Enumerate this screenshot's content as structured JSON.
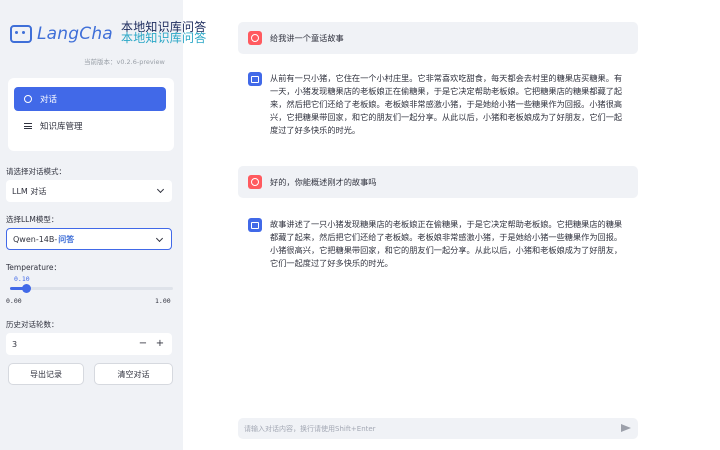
{
  "sidebar": {
    "logo_text": "LangCha",
    "logo_overlay_line1": "本地知识库问答",
    "logo_overlay_line2": "本地知识库问答",
    "version": "当前版本：v0.2.6-preview",
    "nav": [
      {
        "label": "对话",
        "icon": "chat-bubble-icon",
        "active": true
      },
      {
        "label": "知识库管理",
        "icon": "database-icon",
        "active": false
      }
    ],
    "mode_label": "请选择对话模式：",
    "mode_value": "LLM 对话",
    "model_label": "选择LLM模型：",
    "model_value": "Qwen-14B-",
    "model_overlay": "问答",
    "temperature_label": "Temperature：",
    "temperature_value": "0.10",
    "temperature": 0.1,
    "temperature_min": "0.00",
    "temperature_max": "1.00",
    "history_label": "历史对话轮数：",
    "history_value": "3",
    "minus": "−",
    "plus": "+",
    "export_label": "导出记录",
    "clear_label": "清空对话"
  },
  "chat": {
    "messages": [
      {
        "role": "user",
        "text": "给我讲一个童话故事"
      },
      {
        "role": "ai",
        "text": "从前有一只小猪，它住在一个小村庄里。它非常喜欢吃甜食，每天都会去村里的糖果店买糖果。有一天，小猪发现糖果店的老板娘正在偷糖果，于是它决定帮助老板娘。它把糖果店的糖果都藏了起来，然后把它们还给了老板娘。老板娘非常感激小猪，于是她给小猪一些糖果作为回报。小猪很高兴，它把糖果带回家，和它的朋友们一起分享。从此以后，小猪和老板娘成为了好朋友，它们一起度过了好多快乐的时光。"
      },
      {
        "role": "user",
        "text": "好的，你能概述刚才的故事吗"
      },
      {
        "role": "ai",
        "text": "故事讲述了一只小猪发现糖果店的老板娘正在偷糖果，于是它决定帮助老板娘。它把糖果店的糖果都藏了起来，然后把它们还给了老板娘。老板娘非常感激小猪，于是她给小猪一些糖果作为回报。小猪很高兴，它把糖果带回家，和它的朋友们一起分享。从此以后，小猪和老板娘成为了好朋友，它们一起度过了好多快乐的时光。"
      }
    ],
    "input_placeholder": "请输入对话内容，换行请使用Shift+Enter"
  },
  "colors": {
    "accent": "#4169e8",
    "user_avatar": "#ff5a5f",
    "sidebar_bg": "#f0f2f6"
  }
}
